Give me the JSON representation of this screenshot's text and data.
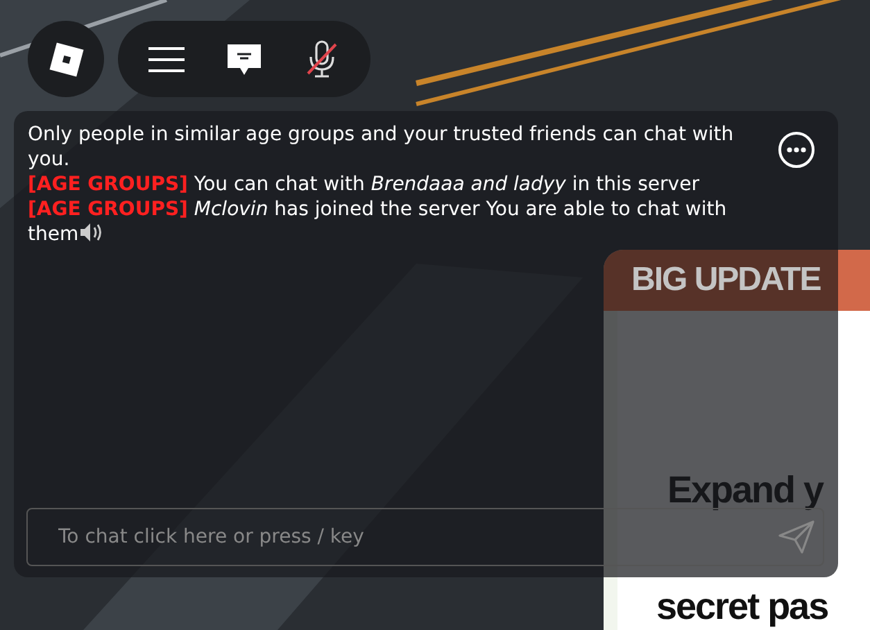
{
  "top_bar": {
    "mic_muted": true
  },
  "chat": {
    "messages": [
      {
        "text": "Only people in similar age groups and your trusted friends can chat with you.",
        "sound_icon": false
      },
      {
        "tag": "[AGE GROUPS]",
        "text": "You can chat with *Brendaaa and ladyy* in this server",
        "sound_icon": false
      },
      {
        "tag": "[AGE GROUPS]",
        "text": "*Mclovin* has joined the server You are able to chat with them",
        "sound_icon": true
      }
    ],
    "input": {
      "placeholder": "To chat click here or press / key"
    }
  },
  "game_panel": {
    "header": "BIG UPDATE",
    "lines": [
      "Expand y",
      "secret pas"
    ]
  }
}
